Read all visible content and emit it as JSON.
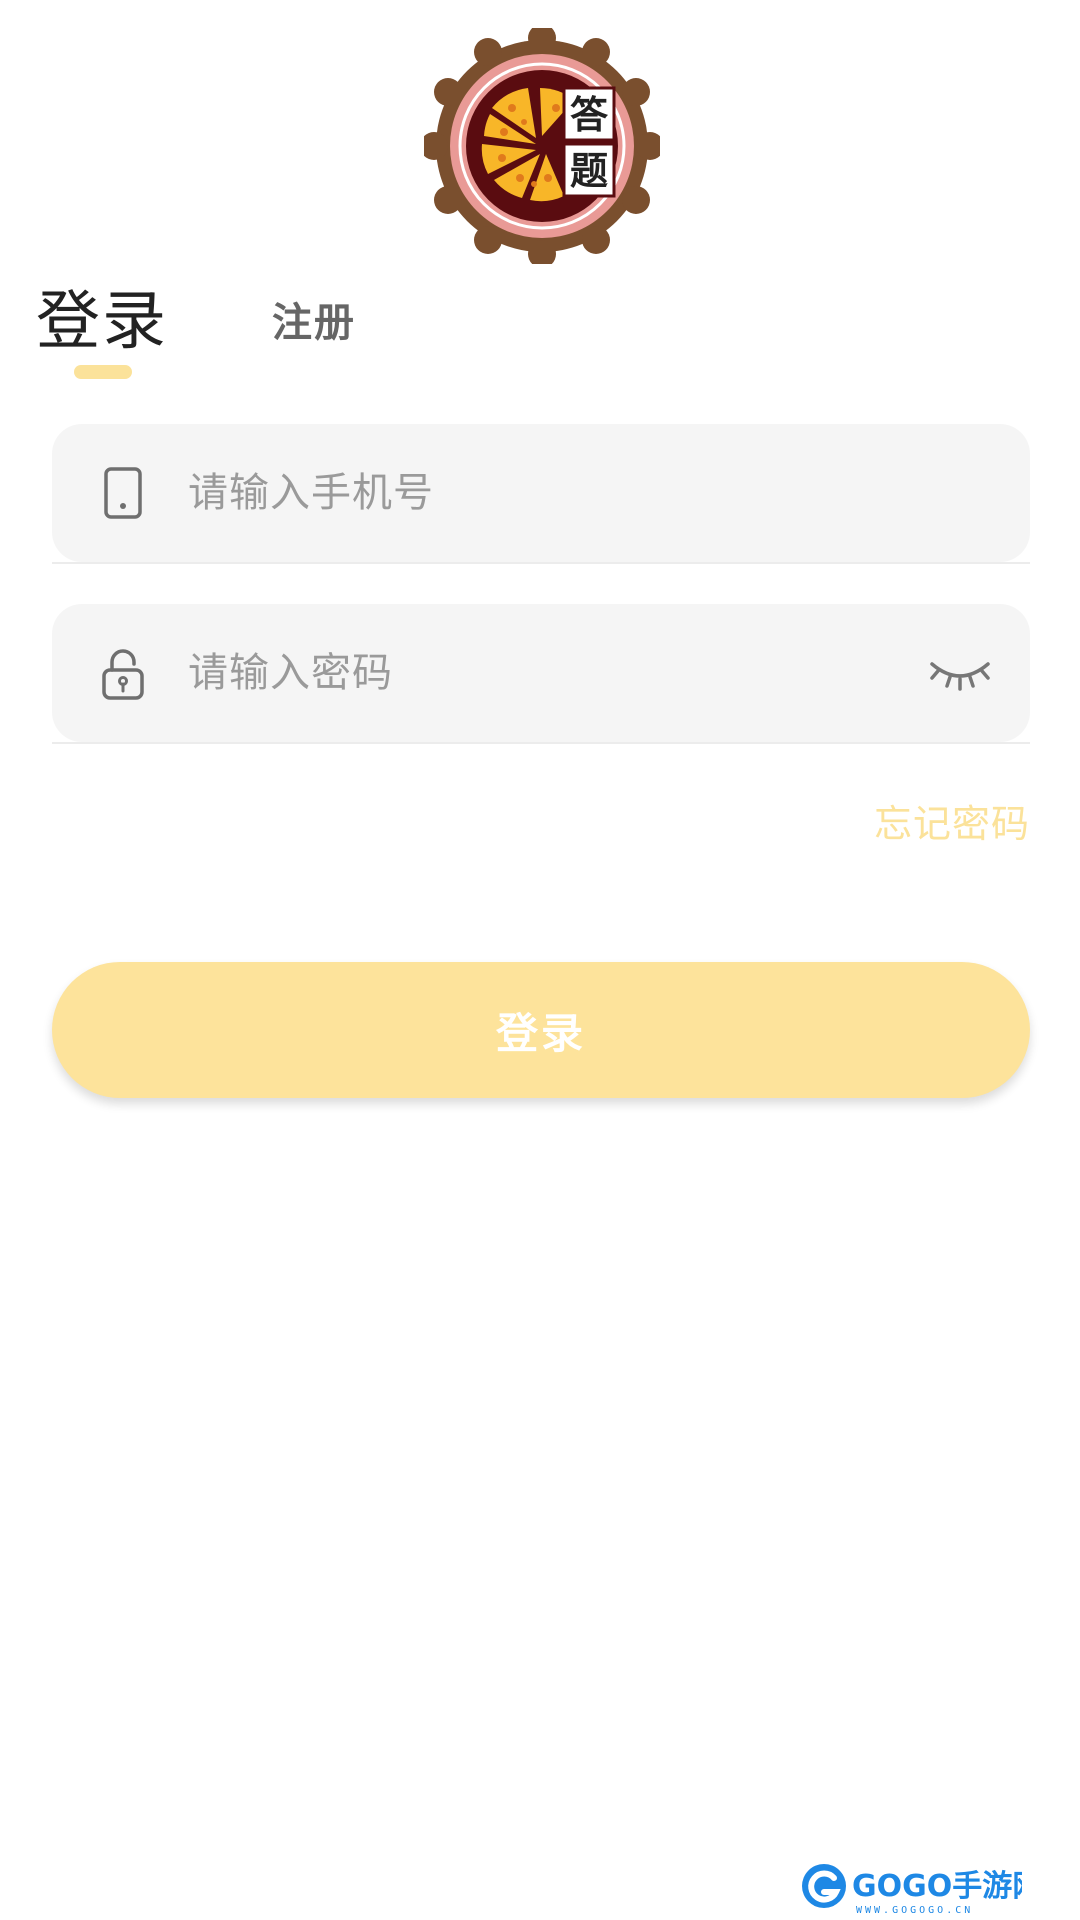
{
  "logo": {
    "text_top": "答",
    "text_bottom": "题"
  },
  "tabs": {
    "login_label": "登录",
    "register_label": "注册",
    "active": "login"
  },
  "phone_field": {
    "placeholder": "请输入手机号",
    "value": "",
    "icon": "phone-icon"
  },
  "password_field": {
    "placeholder": "请输入密码",
    "value": "",
    "icon": "lock-icon",
    "toggle_icon": "eye-closed-icon"
  },
  "forgot_password_label": "忘记密码",
  "login_button_label": "登录",
  "watermark": {
    "brand": "GOGO手游网",
    "url": "WWW.GOGOGO.CN"
  },
  "colors": {
    "accent": "#fde39b",
    "accent_text": "#fbe29a",
    "field_bg": "#f5f5f5",
    "logo_brown": "#7a4f2e",
    "logo_dark": "#5a0c10"
  }
}
